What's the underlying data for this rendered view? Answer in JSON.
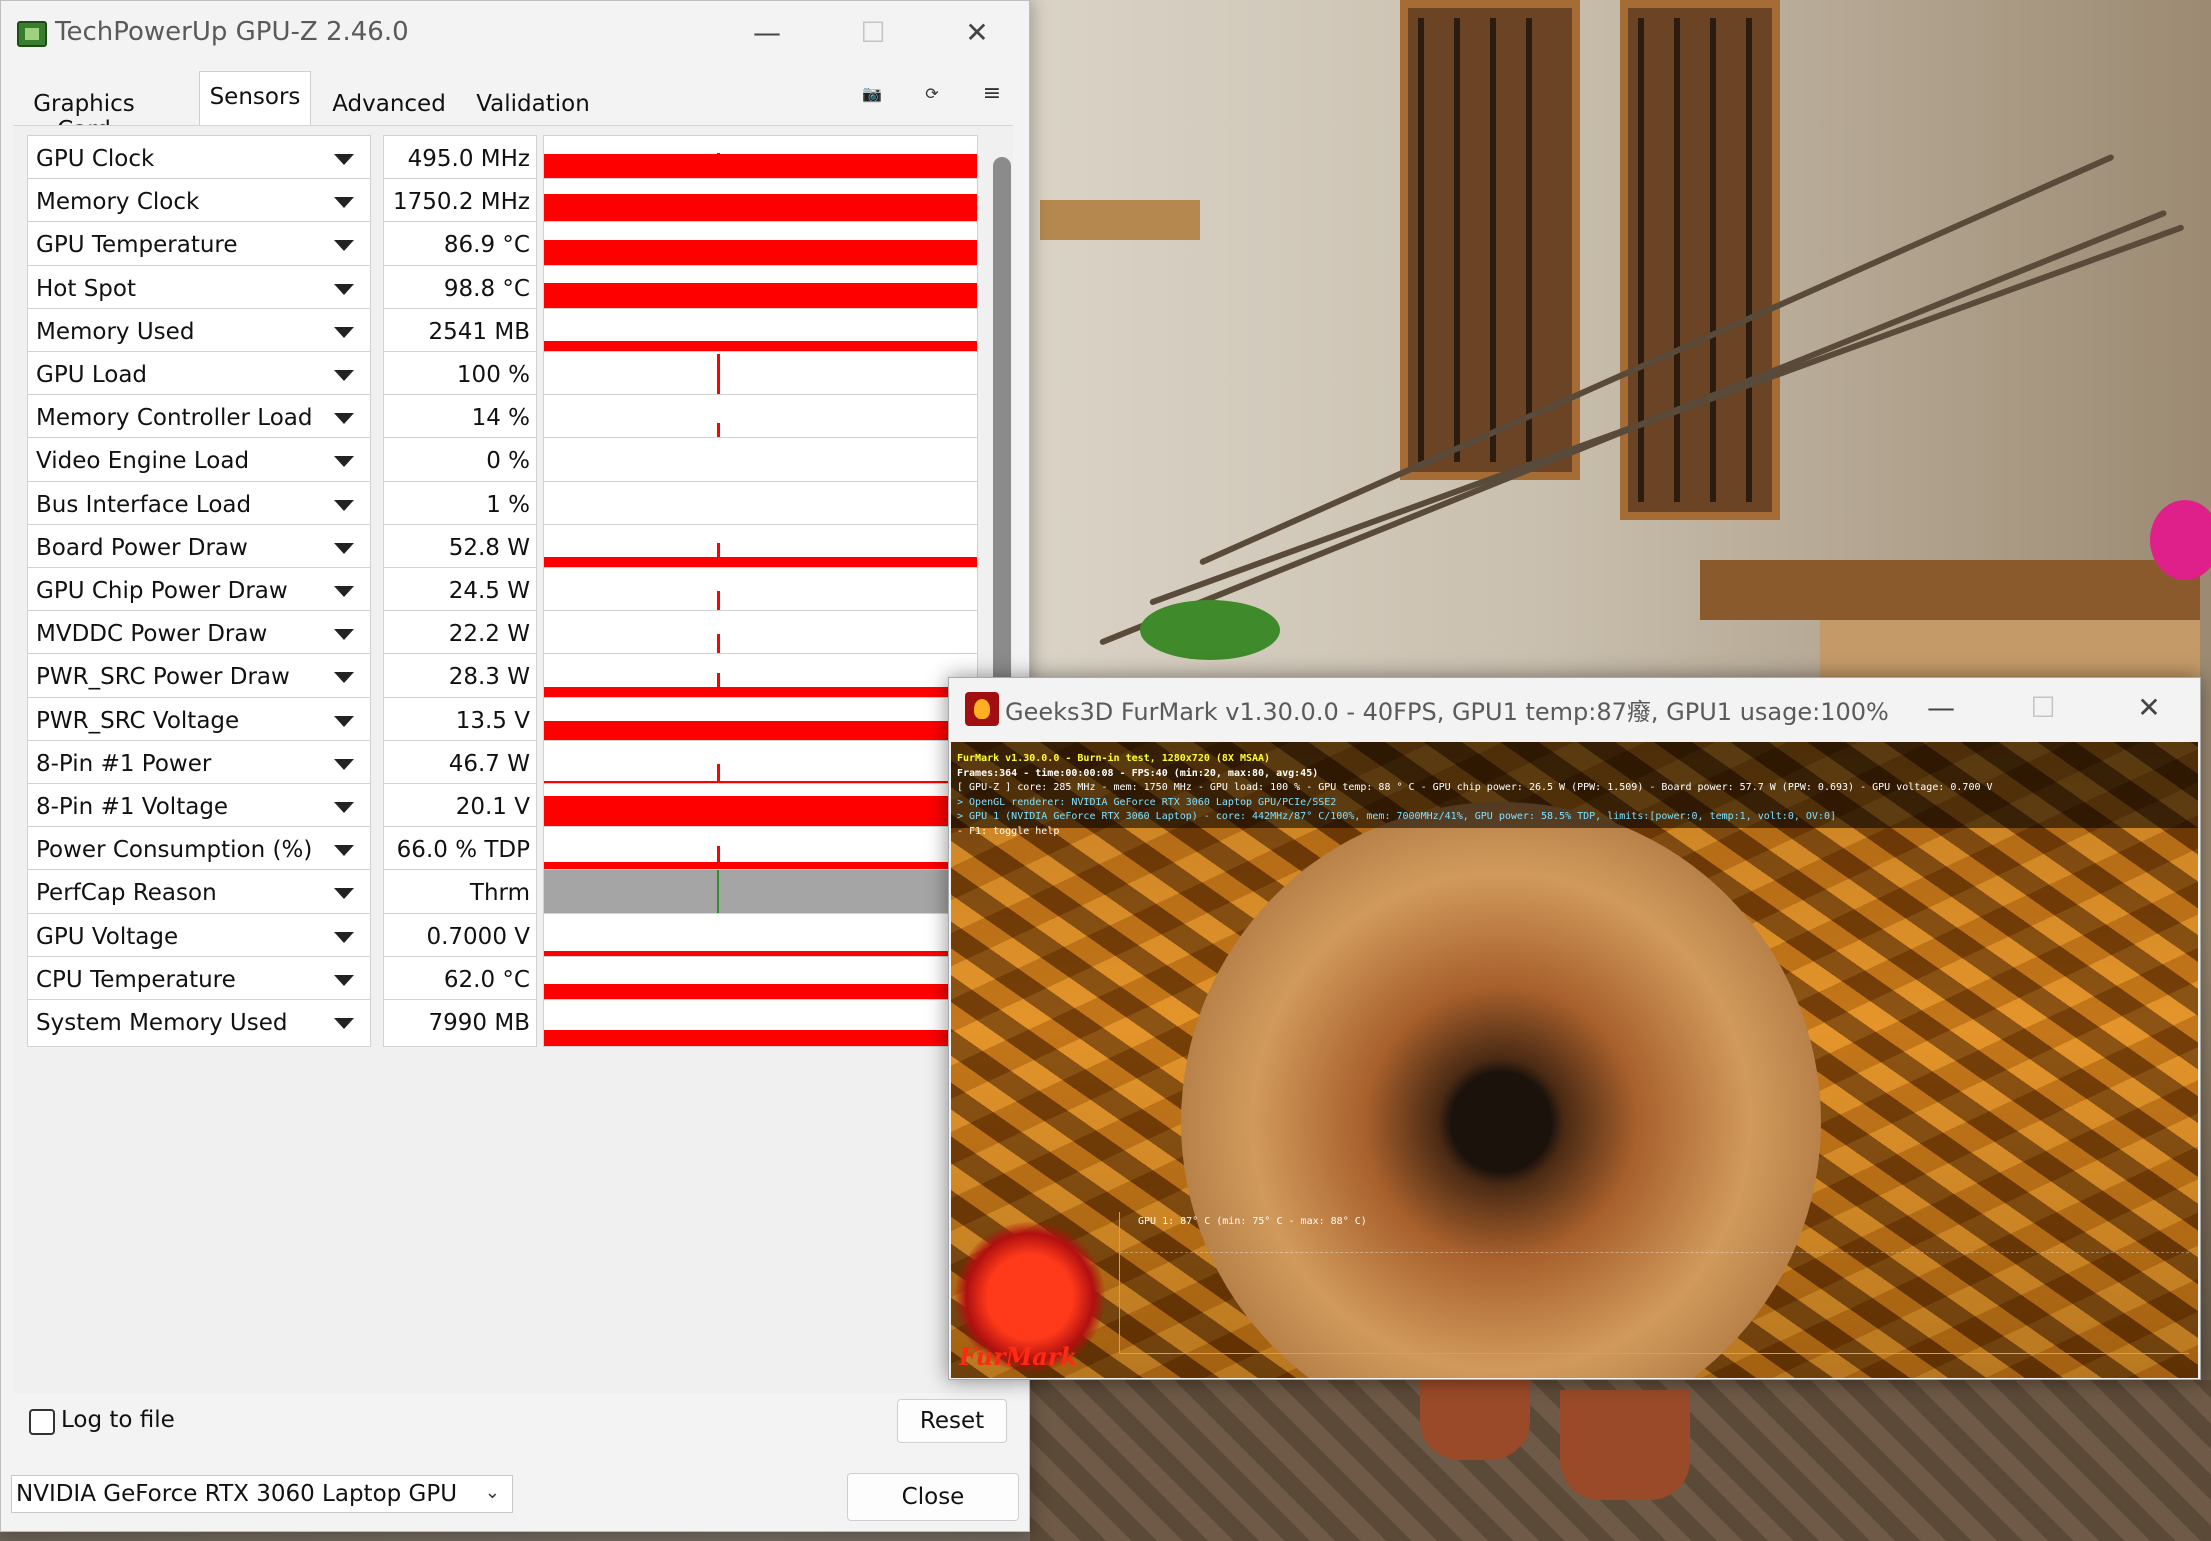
{
  "gpuz": {
    "title": "TechPowerUp GPU-Z 2.46.0",
    "window_buttons": {
      "minimize": "—",
      "maximize": "☐",
      "close": "✕"
    },
    "tabs": [
      {
        "label": "Graphics Card",
        "active": false
      },
      {
        "label": "Sensors",
        "active": true
      },
      {
        "label": "Advanced",
        "active": false
      },
      {
        "label": "Validation",
        "active": false
      }
    ],
    "toolbar": {
      "camera_icon": "camera-icon",
      "refresh_icon": "refresh-icon",
      "menu_icon": "menu-icon"
    },
    "sensors": [
      {
        "name": "GPU Clock",
        "value": "495.0 MHz",
        "level": 0.6,
        "spike": 0.62
      },
      {
        "name": "Memory Clock",
        "value": "1750.2 MHz",
        "level": 0.68,
        "spike": 0
      },
      {
        "name": "GPU Temperature",
        "value": "86.9 °C",
        "level": 0.62,
        "spike": 0
      },
      {
        "name": "Hot Spot",
        "value": "98.8 °C",
        "level": 0.62,
        "spike": 0
      },
      {
        "name": "Memory Used",
        "value": "2541 MB",
        "level": 0.3,
        "spike": 0
      },
      {
        "name": "GPU Load",
        "value": "100 %",
        "level": 0.04,
        "spike": 0.95
      },
      {
        "name": "Memory Controller Load",
        "value": "14 %",
        "level": 0.04,
        "spike": 0.4
      },
      {
        "name": "Video Engine Load",
        "value": "0 %",
        "level": 0.0,
        "spike": 0
      },
      {
        "name": "Bus Interface Load",
        "value": "1 %",
        "level": 0.02,
        "spike": 0
      },
      {
        "name": "Board Power Draw",
        "value": "52.8 W",
        "level": 0.3,
        "spike": 0.6
      },
      {
        "name": "GPU Chip Power Draw",
        "value": "24.5 W",
        "level": 0.05,
        "spike": 0.5
      },
      {
        "name": "MVDDC Power Draw",
        "value": "22.2 W",
        "level": 0.1,
        "spike": 0.5
      },
      {
        "name": "PWR_SRC Power Draw",
        "value": "28.3 W",
        "level": 0.3,
        "spike": 0.6
      },
      {
        "name": "PWR_SRC Voltage",
        "value": "13.5 V",
        "level": 0.5,
        "spike": 0
      },
      {
        "name": "8-Pin #1 Power",
        "value": "46.7 W",
        "level": 0.12,
        "spike": 0.5
      },
      {
        "name": "8-Pin #1 Voltage",
        "value": "20.1 V",
        "level": 0.75,
        "spike": 0
      },
      {
        "name": "Power Consumption (%)",
        "value": "66.0 % TDP",
        "level": 0.25,
        "spike": 0.6
      },
      {
        "name": "PerfCap Reason",
        "value": "Thrm",
        "level": 0,
        "spike": 0,
        "gray": true
      },
      {
        "name": "GPU Voltage",
        "value": "0.7000 V",
        "level": 0.18,
        "spike": 0
      },
      {
        "name": "CPU Temperature",
        "value": "62.0 °C",
        "level": 0.4,
        "spike": 0
      },
      {
        "name": "System Memory Used",
        "value": "7990 MB",
        "level": 0.35,
        "spike": 0
      }
    ],
    "log_to_file": "Log to file",
    "reset": "Reset",
    "gpu_select": "NVIDIA GeForce RTX 3060 Laptop GPU",
    "close": "Close"
  },
  "furmark": {
    "title": "Geeks3D FurMark v1.30.0.0 - 40FPS, GPU1 temp:87癈, GPU1 usage:100%",
    "hud": [
      "FurMark v1.30.0.0 - Burn-in test, 1280x720 (8X MSAA)",
      "Frames:364 - time:00:00:08 - FPS:40 (min:20, max:80, avg:45)",
      "[ GPU-Z ] core: 285 MHz - mem: 1750 MHz - GPU load: 100 % - GPU temp: 88 ° C - GPU chip power: 26.5 W (PPW: 1.509) - Board power: 57.7 W (PPW: 0.693) - GPU voltage: 0.700 V",
      "> OpenGL renderer: NVIDIA GeForce RTX 3060 Laptop GPU/PCIe/SSE2",
      "> GPU 1 (NVIDIA GeForce RTX 3060 Laptop) - core: 442MHz/87° C/100%, mem: 7000MHz/41%, GPU power: 58.5% TDP, limits:[power:0, temp:1, volt:0, OV:0]",
      "- F1: toggle help"
    ],
    "temp_graph_label": "GPU 1: 87° C (min: 75° C - max: 88° C)",
    "logo": "FurMark"
  }
}
